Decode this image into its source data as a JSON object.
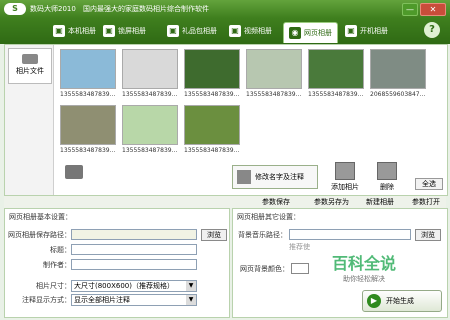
{
  "app": {
    "logo": "S",
    "title": "数码大师2010",
    "subtitle": "国内最强大的家庭数码相片综合制作软件",
    "min": "—",
    "close": "✕"
  },
  "tabs": [
    {
      "label": "本机相册",
      "icon": "album-icon"
    },
    {
      "label": "锁屏相册",
      "icon": "lock-album-icon"
    },
    {
      "label": "礼品包相册",
      "icon": "gift-album-icon"
    },
    {
      "label": "视频相册",
      "icon": "video-album-icon"
    },
    {
      "label": "网页相册",
      "icon": "web-album-icon",
      "active": true
    },
    {
      "label": "开机相册",
      "icon": "boot-album-icon"
    }
  ],
  "help": "?",
  "sidebar": {
    "label": "相片文件"
  },
  "thumbs": [
    {
      "caption": "1355583487839....",
      "color": "#8bbad8"
    },
    {
      "caption": "1355583487839....",
      "color": "#d9d9d9"
    },
    {
      "caption": "1355583487839....",
      "color": "#3e6b2e"
    },
    {
      "caption": "1355583487839....",
      "color": "#b7c7b0"
    },
    {
      "caption": "1355583487839....",
      "color": "#4a7a3b"
    },
    {
      "caption": "2068559603847....",
      "color": "#7f8c84"
    },
    {
      "caption": "1355583487839....",
      "color": "#8f8f72"
    },
    {
      "caption": "1355583487839....",
      "color": "#b8d7a8"
    },
    {
      "caption": "1355583487839....",
      "color": "#6b8f3f"
    }
  ],
  "actions": {
    "rename": "修改名字及注释",
    "add": "添加相片",
    "delete": "删除",
    "select_all": "全选"
  },
  "subtoolbar": {
    "save": "参数保存",
    "save_as": "参数另存为",
    "new": "新建相册",
    "open": "参数打开"
  },
  "left_panel": {
    "title": "网页相册基本设置：",
    "save_path_label": "网页相册保存路径：",
    "browse": "浏览",
    "title_label": "标题：",
    "author_label": "制作者：",
    "size_label": "相片尺寸：",
    "size_value": "大尺寸(800X600)（推荐规格）",
    "display_label": "注释显示方式：",
    "display_value": "显示全部相片注释"
  },
  "right_panel": {
    "title": "网页相册其它设置：",
    "music_label": "背景音乐路径：",
    "browse": "浏览",
    "music_hint": "推荐使",
    "bgcolor_label": "网页背景颜色："
  },
  "generate": {
    "label": "开始生成",
    "icon": "▶"
  },
  "watermark": {
    "line1": "百科全说",
    "line2": "助你轻松解决"
  }
}
